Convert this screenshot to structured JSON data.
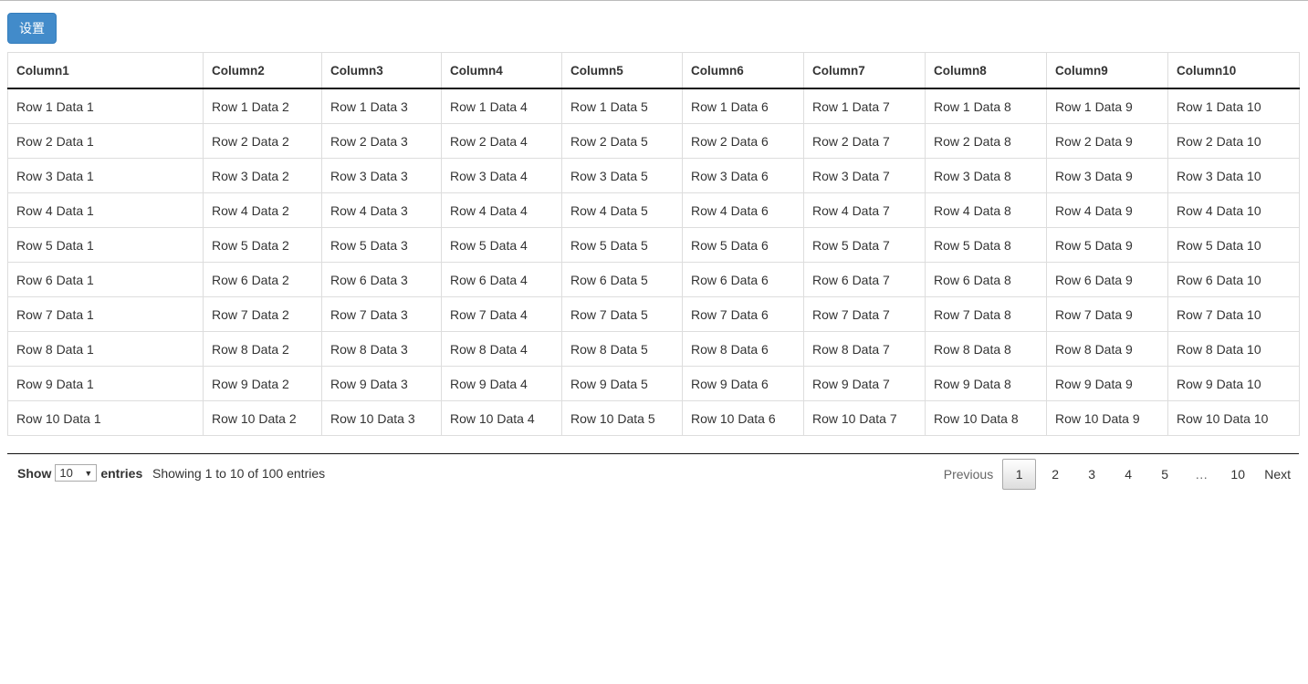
{
  "toolbar": {
    "settings_label": "设置"
  },
  "table": {
    "columns": [
      "Column1",
      "Column2",
      "Column3",
      "Column4",
      "Column5",
      "Column6",
      "Column7",
      "Column8",
      "Column9",
      "Column10"
    ],
    "rows": [
      [
        "Row 1 Data 1",
        "Row 1 Data 2",
        "Row 1 Data 3",
        "Row 1 Data 4",
        "Row 1 Data 5",
        "Row 1 Data 6",
        "Row 1 Data 7",
        "Row 1 Data 8",
        "Row 1 Data 9",
        "Row 1 Data 10"
      ],
      [
        "Row 2 Data 1",
        "Row 2 Data 2",
        "Row 2 Data 3",
        "Row 2 Data 4",
        "Row 2 Data 5",
        "Row 2 Data 6",
        "Row 2 Data 7",
        "Row 2 Data 8",
        "Row 2 Data 9",
        "Row 2 Data 10"
      ],
      [
        "Row 3 Data 1",
        "Row 3 Data 2",
        "Row 3 Data 3",
        "Row 3 Data 4",
        "Row 3 Data 5",
        "Row 3 Data 6",
        "Row 3 Data 7",
        "Row 3 Data 8",
        "Row 3 Data 9",
        "Row 3 Data 10"
      ],
      [
        "Row 4 Data 1",
        "Row 4 Data 2",
        "Row 4 Data 3",
        "Row 4 Data 4",
        "Row 4 Data 5",
        "Row 4 Data 6",
        "Row 4 Data 7",
        "Row 4 Data 8",
        "Row 4 Data 9",
        "Row 4 Data 10"
      ],
      [
        "Row 5 Data 1",
        "Row 5 Data 2",
        "Row 5 Data 3",
        "Row 5 Data 4",
        "Row 5 Data 5",
        "Row 5 Data 6",
        "Row 5 Data 7",
        "Row 5 Data 8",
        "Row 5 Data 9",
        "Row 5 Data 10"
      ],
      [
        "Row 6 Data 1",
        "Row 6 Data 2",
        "Row 6 Data 3",
        "Row 6 Data 4",
        "Row 6 Data 5",
        "Row 6 Data 6",
        "Row 6 Data 7",
        "Row 6 Data 8",
        "Row 6 Data 9",
        "Row 6 Data 10"
      ],
      [
        "Row 7 Data 1",
        "Row 7 Data 2",
        "Row 7 Data 3",
        "Row 7 Data 4",
        "Row 7 Data 5",
        "Row 7 Data 6",
        "Row 7 Data 7",
        "Row 7 Data 8",
        "Row 7 Data 9",
        "Row 7 Data 10"
      ],
      [
        "Row 8 Data 1",
        "Row 8 Data 2",
        "Row 8 Data 3",
        "Row 8 Data 4",
        "Row 8 Data 5",
        "Row 8 Data 6",
        "Row 8 Data 7",
        "Row 8 Data 8",
        "Row 8 Data 9",
        "Row 8 Data 10"
      ],
      [
        "Row 9 Data 1",
        "Row 9 Data 2",
        "Row 9 Data 3",
        "Row 9 Data 4",
        "Row 9 Data 5",
        "Row 9 Data 6",
        "Row 9 Data 7",
        "Row 9 Data 8",
        "Row 9 Data 9",
        "Row 9 Data 10"
      ],
      [
        "Row 10 Data 1",
        "Row 10 Data 2",
        "Row 10 Data 3",
        "Row 10 Data 4",
        "Row 10 Data 5",
        "Row 10 Data 6",
        "Row 10 Data 7",
        "Row 10 Data 8",
        "Row 10 Data 9",
        "Row 10 Data 10"
      ]
    ]
  },
  "length": {
    "show_label": "Show",
    "value": "10",
    "entries_label": "entries"
  },
  "info": "Showing 1 to 10 of 100 entries",
  "pagination": {
    "previous": "Previous",
    "pages": [
      "1",
      "2",
      "3",
      "4",
      "5"
    ],
    "ellipsis": "…",
    "last": "10",
    "next": "Next",
    "current": "1"
  },
  "colors": {
    "button": "#428bca"
  }
}
